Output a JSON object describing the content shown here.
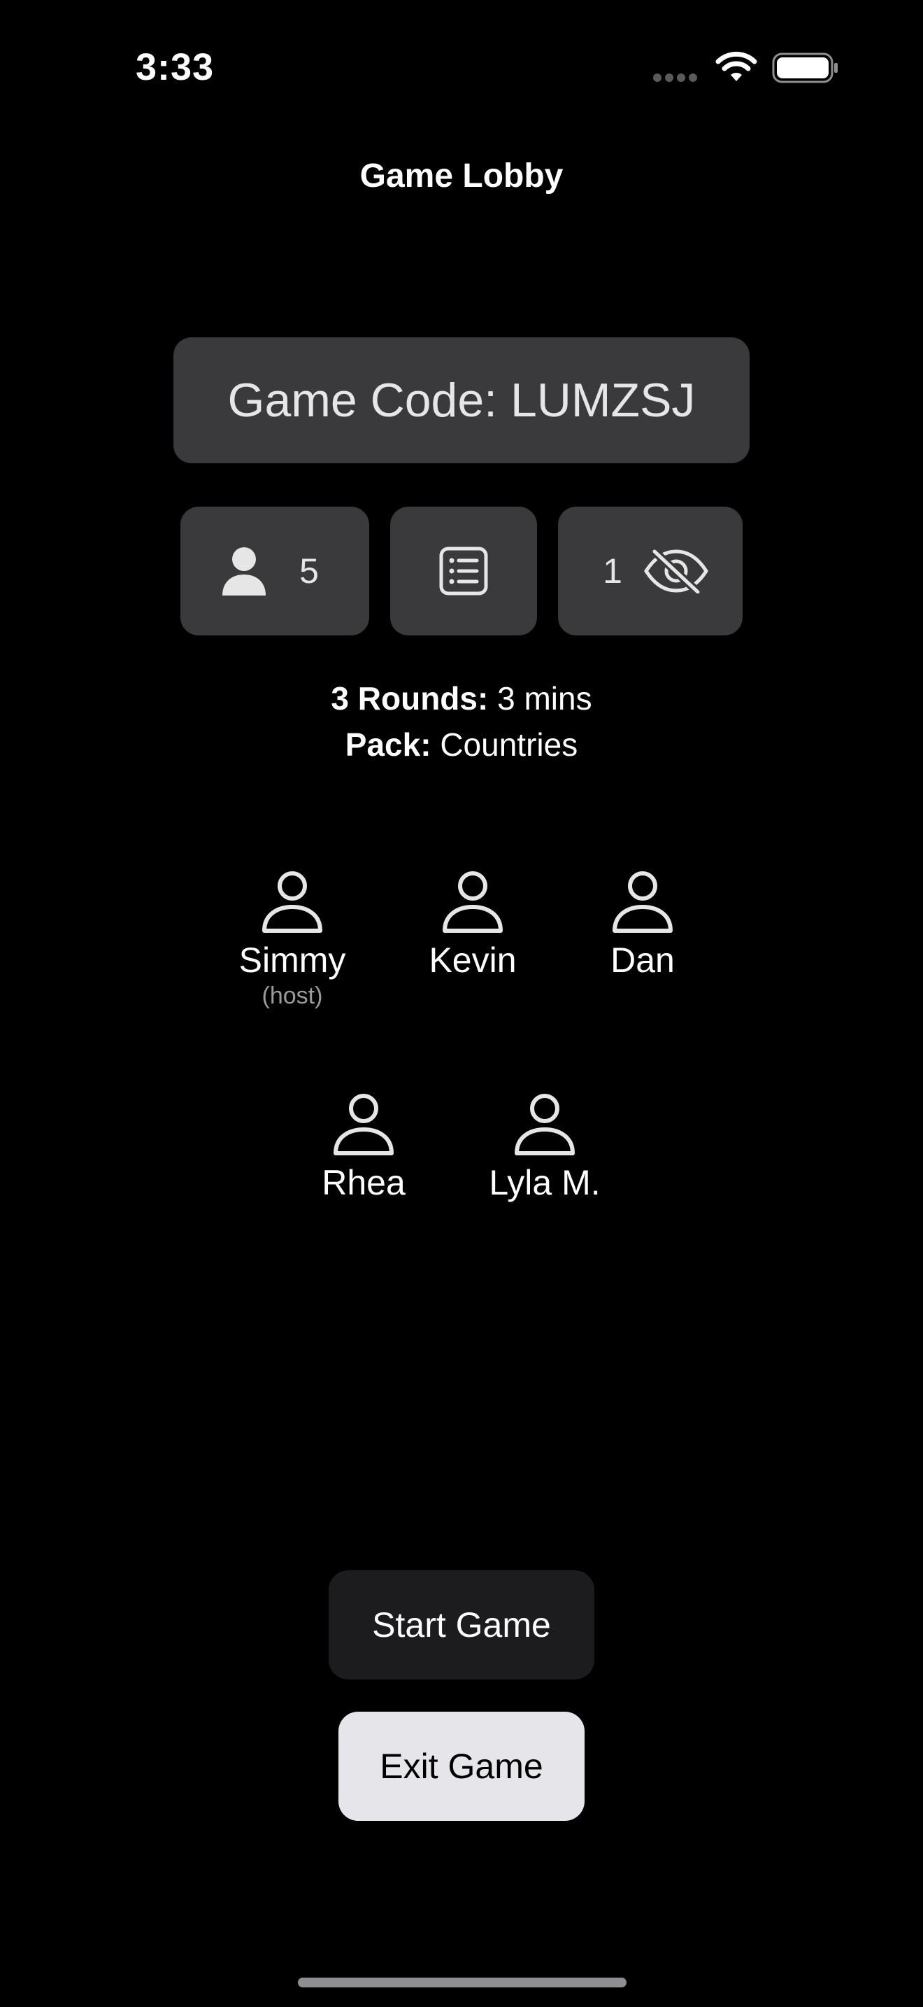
{
  "status_bar": {
    "time": "3:33",
    "icons": [
      "signal-icon",
      "wifi-icon",
      "battery-icon"
    ]
  },
  "nav": {
    "title": "Game Lobby"
  },
  "game_code": {
    "text": "Game Code: LUMZSJ"
  },
  "info_buttons": {
    "players": {
      "icon": "person-icon",
      "count": "5"
    },
    "list": {
      "icon": "list-icon"
    },
    "hidden": {
      "count": "1",
      "icon": "eye-slash-icon"
    }
  },
  "settings": {
    "rounds_label": "3 Rounds:",
    "rounds_value": "3 mins",
    "pack_label": "Pack:",
    "pack_value": "Countries"
  },
  "players": [
    {
      "name": "Simmy",
      "role": "(host)"
    },
    {
      "name": "Kevin"
    },
    {
      "name": "Dan"
    },
    {
      "name": "Rhea"
    },
    {
      "name": "Lyla M."
    }
  ],
  "actions": {
    "start_label": "Start Game",
    "exit_label": "Exit Game"
  },
  "colors": {
    "background": "#000000",
    "card": "#3a3a3c",
    "start_button": "#1c1c1e",
    "exit_button": "#e5e5ea"
  }
}
